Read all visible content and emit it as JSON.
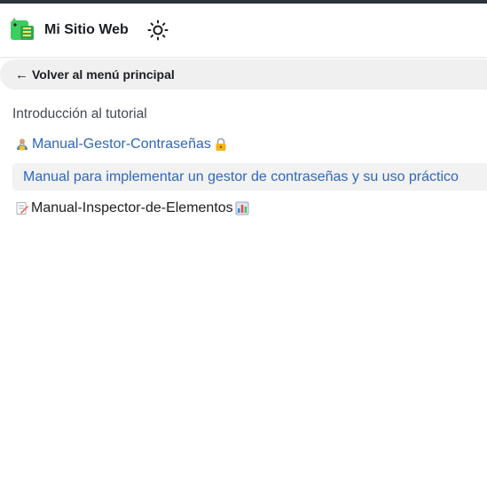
{
  "navbar": {
    "title": "Mi Sitio Web",
    "logo_icon": "dinosaur-logo-icon",
    "theme_icon": "sun-icon"
  },
  "sidebar": {
    "back_arrow": "←",
    "back_label": "Volver al menú principal",
    "items": [
      {
        "label": "Introducción al tutorial"
      },
      {
        "label": "Manual-Gestor-Contraseñas",
        "prefix_icon": "person-lock-icon",
        "suffix_icon": "lock-icon"
      },
      {
        "label": "Manual para implementar un gestor de contraseñas y su uso práctico",
        "active": true
      },
      {
        "label": "Manual-Inspector-de-Elementos",
        "prefix_icon": "memo-icon",
        "suffix_icon": "bar-chart-icon"
      }
    ]
  },
  "colors": {
    "link": "#2e67b9",
    "text": "#1c1e21",
    "active_bg": "#f2f2f2",
    "top_border": "#2c3339"
  }
}
